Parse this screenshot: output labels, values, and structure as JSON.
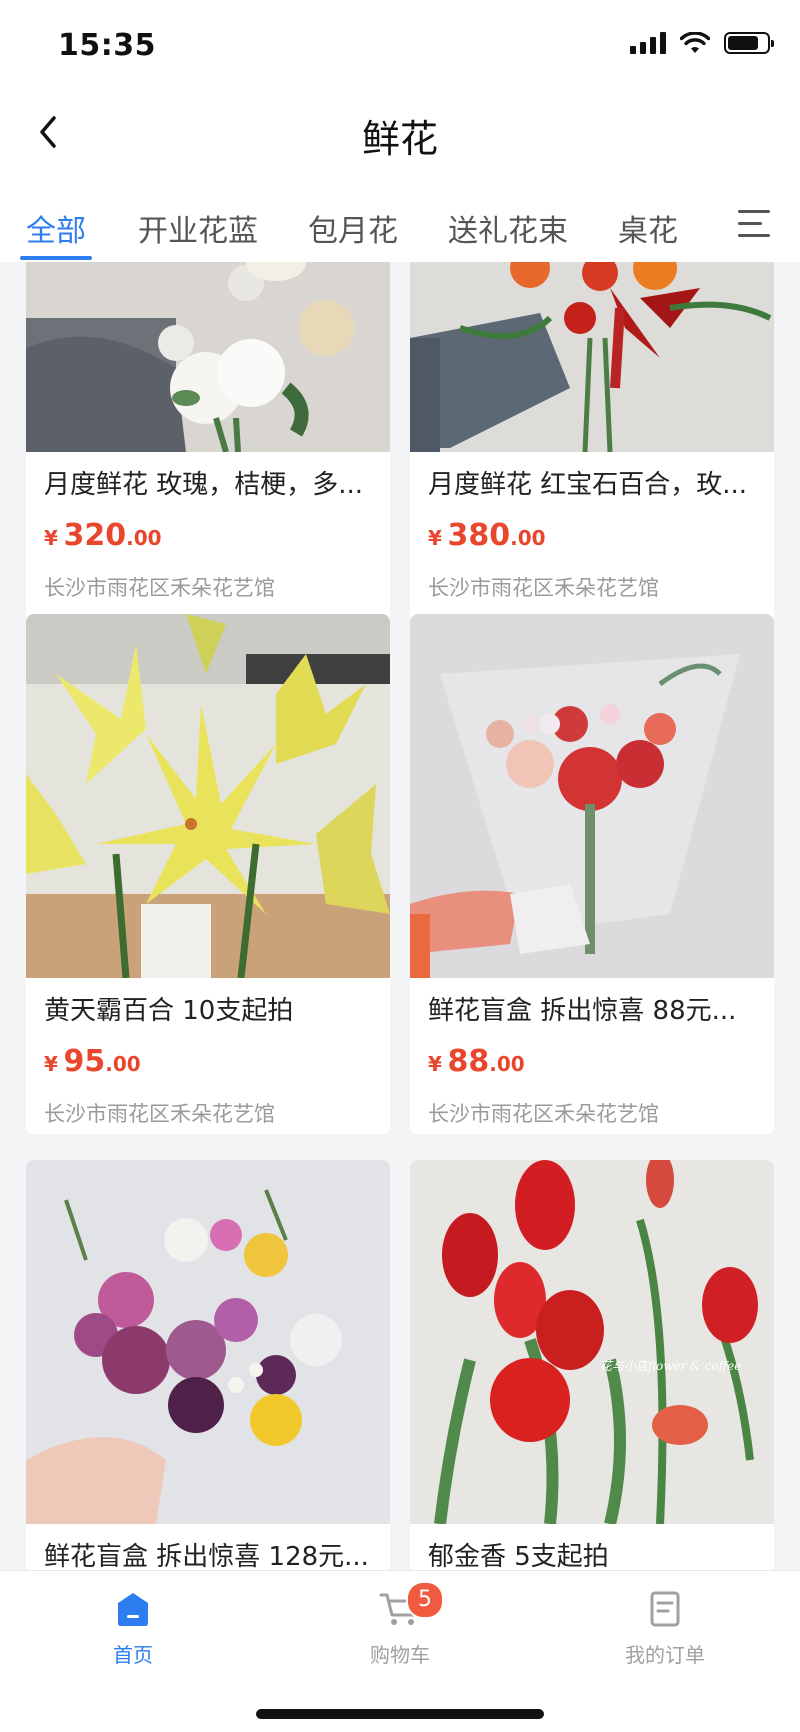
{
  "status_bar": {
    "time": "15:35"
  },
  "header": {
    "title": "鲜花"
  },
  "tabs": [
    {
      "label": "全部",
      "active": true
    },
    {
      "label": "开业花蓝",
      "active": false
    },
    {
      "label": "包月花",
      "active": false
    },
    {
      "label": "送礼花束",
      "active": false
    },
    {
      "label": "桌花",
      "active": false
    }
  ],
  "products": [
    {
      "name": "月度鲜花 玫瑰，桔梗，多...",
      "currency": "¥",
      "price_int": "320",
      "price_dec": ".00",
      "shop": "长沙市雨花区禾朵花艺馆"
    },
    {
      "name": "月度鲜花 红宝石百合，玫...",
      "currency": "¥",
      "price_int": "380",
      "price_dec": ".00",
      "shop": "长沙市雨花区禾朵花艺馆"
    },
    {
      "name": "黄天霸百合 10支起拍",
      "currency": "¥",
      "price_int": "95",
      "price_dec": ".00",
      "shop": "长沙市雨花区禾朵花艺馆"
    },
    {
      "name": "鲜花盲盒 拆出惊喜 88元...",
      "currency": "¥",
      "price_int": "88",
      "price_dec": ".00",
      "shop": "长沙市雨花区禾朵花艺馆"
    },
    {
      "name": "鲜花盲盒 拆出惊喜 128元...",
      "currency": "¥",
      "price_int": "",
      "price_dec": "",
      "shop": ""
    },
    {
      "name": "郁金香 5支起拍",
      "currency": "¥",
      "price_int": "",
      "price_dec": "",
      "shop": ""
    }
  ],
  "watermark": "花与小店flower & coffee",
  "tabbar": {
    "home_label": "首页",
    "cart_label": "购物车",
    "cart_count": "5",
    "orders_label": "我的订单"
  },
  "colors": {
    "accent": "#2d7df0",
    "price": "#e8472d",
    "badge": "#f05a3f"
  }
}
